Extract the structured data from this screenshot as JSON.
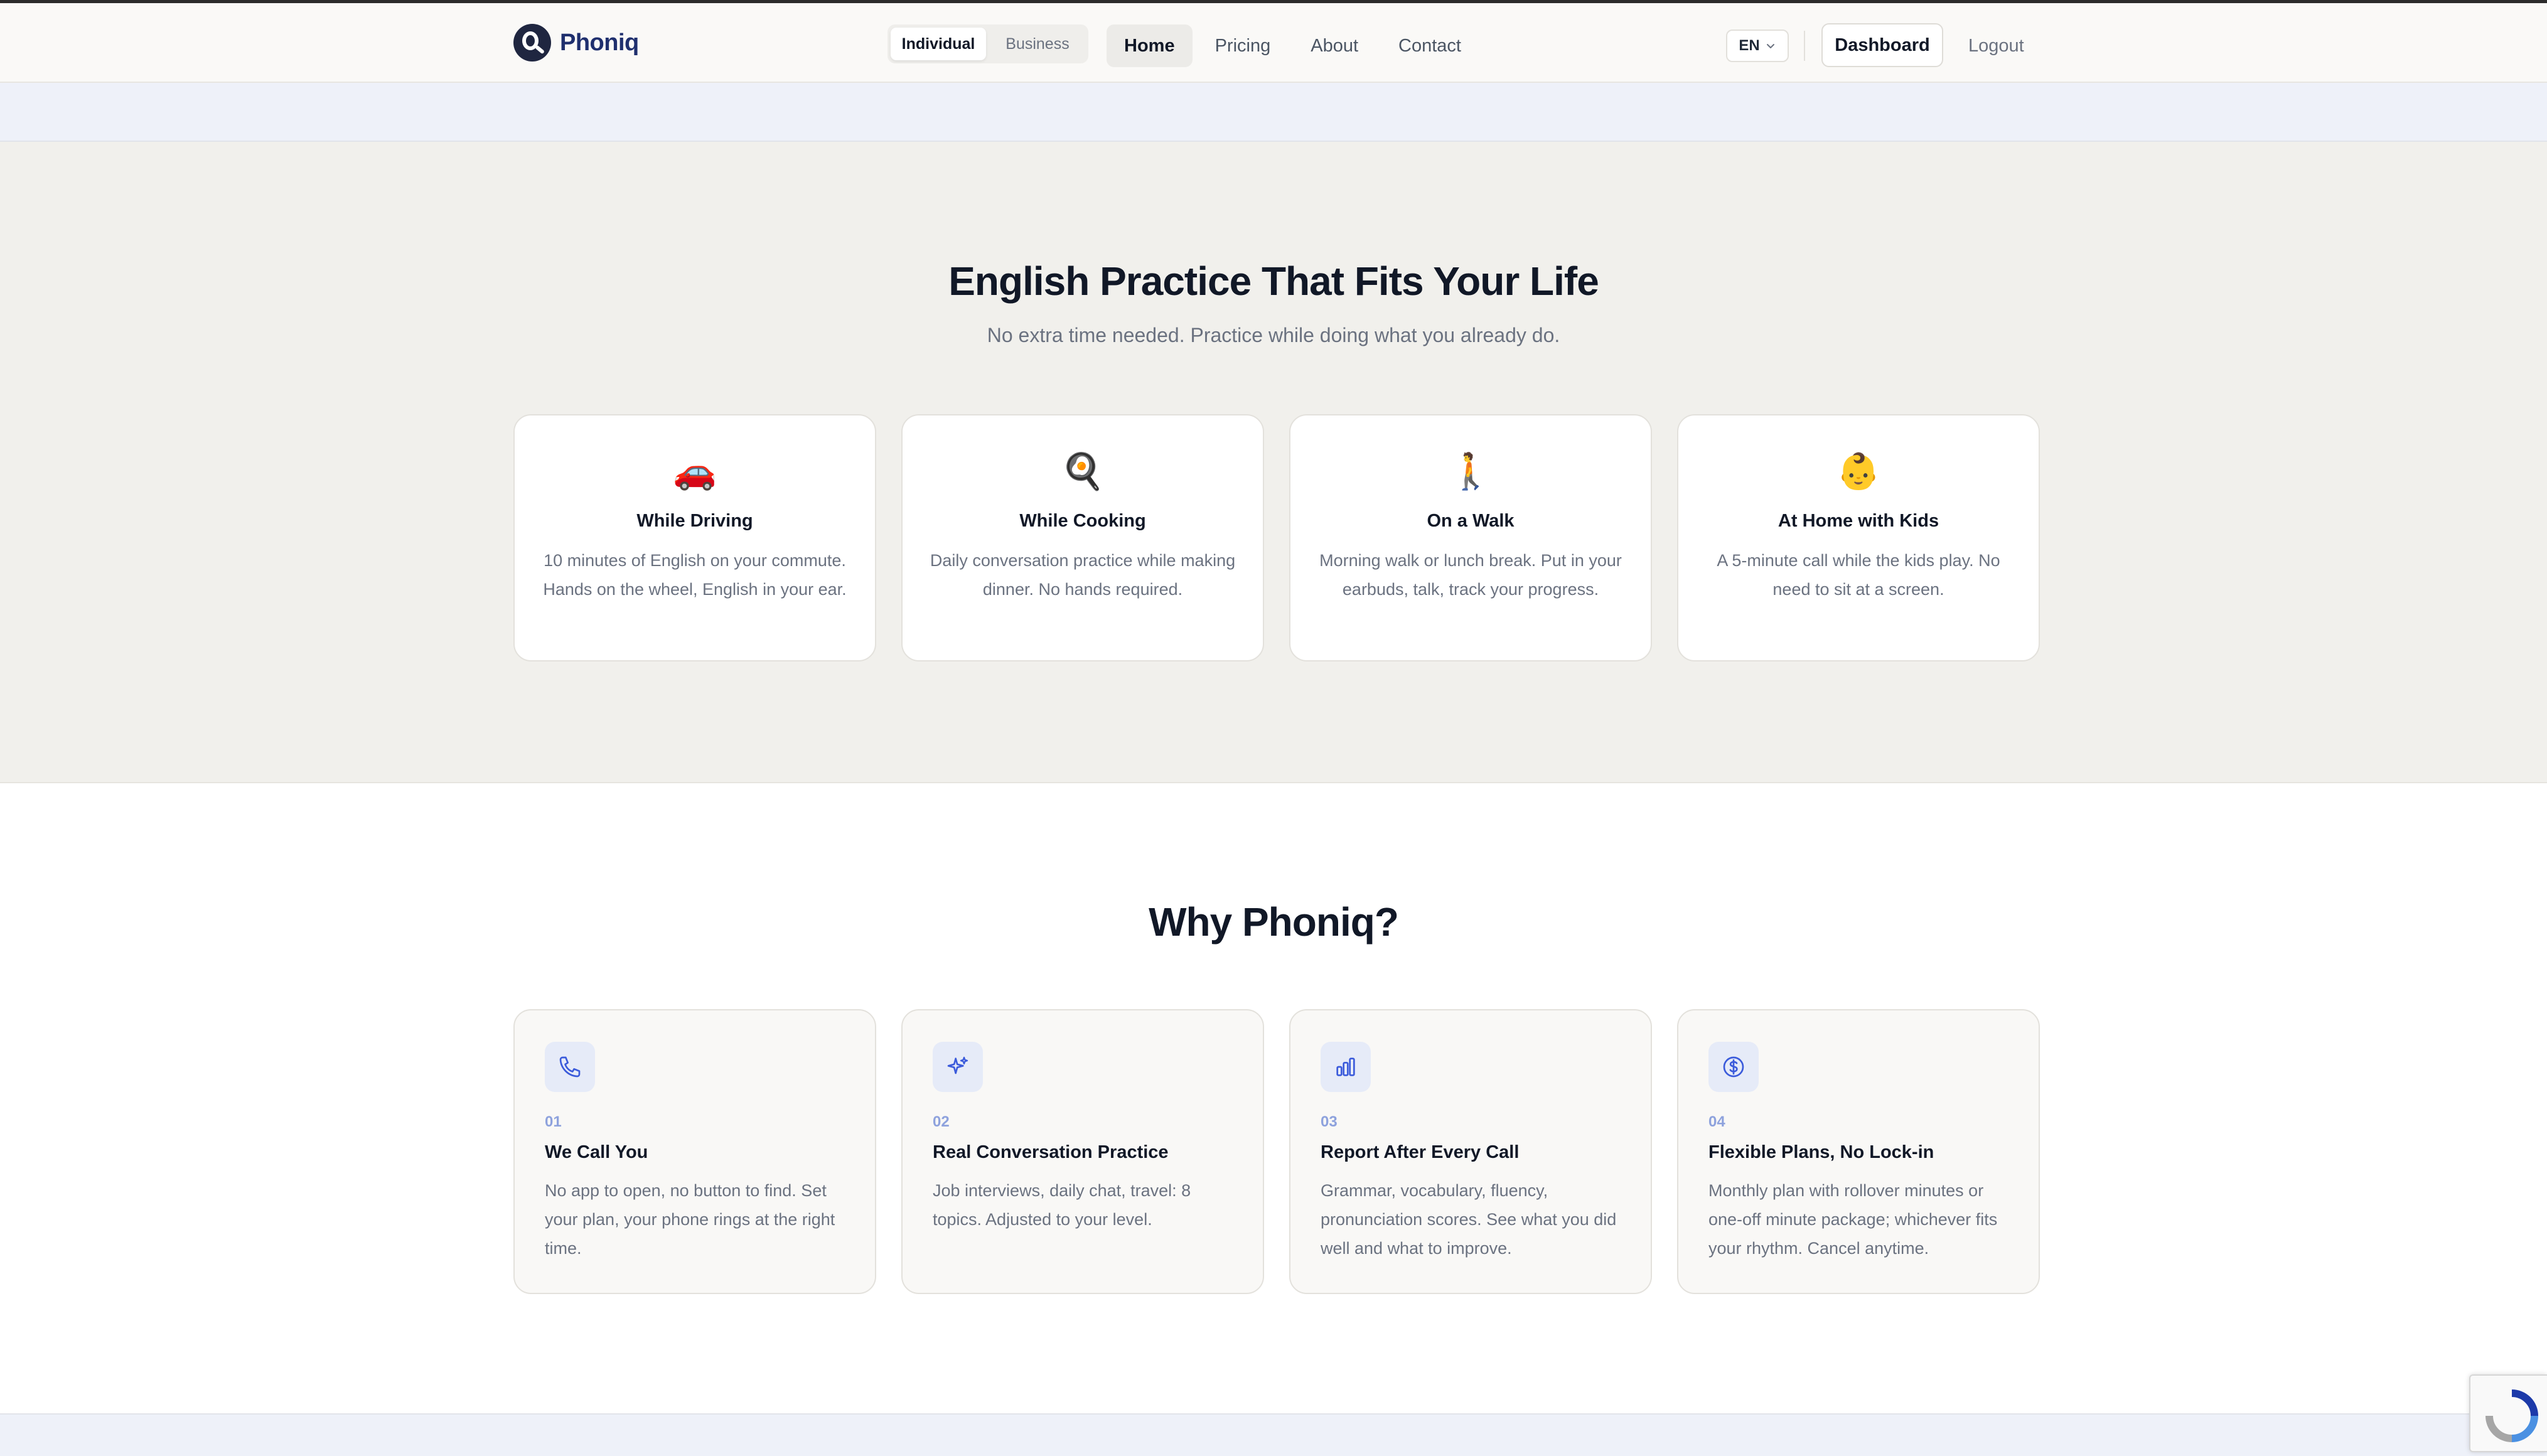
{
  "header": {
    "logo_text": "Phoniq",
    "segment": [
      "Individual",
      "Business"
    ],
    "nav": [
      "Home",
      "Pricing",
      "About",
      "Contact"
    ],
    "lang": "EN",
    "dashboard": "Dashboard",
    "logout": "Logout"
  },
  "life": {
    "title": "English Practice That Fits Your Life",
    "subtitle": "No extra time needed. Practice while doing what you already do.",
    "cards": [
      {
        "emoji": "🚗",
        "title": "While Driving",
        "desc": "10 minutes of English on your commute. Hands on the wheel, English in your ear."
      },
      {
        "emoji": "🍳",
        "title": "While Cooking",
        "desc": "Daily conversation practice while making dinner. No hands required."
      },
      {
        "emoji": "🚶",
        "title": "On a Walk",
        "desc": "Morning walk or lunch break. Put in your earbuds, talk, track your progress."
      },
      {
        "emoji": "👶",
        "title": "At Home with Kids",
        "desc": "A 5-minute call while the kids play. No need to sit at a screen."
      }
    ]
  },
  "why": {
    "title": "Why Phoniq?",
    "cards": [
      {
        "num": "01",
        "icon": "phone-icon",
        "title": "We Call You",
        "desc": "No app to open, no button to find. Set your plan, your phone rings at the right time."
      },
      {
        "num": "02",
        "icon": "sparkles-icon",
        "title": "Real Conversation Practice",
        "desc": "Job interviews, daily chat, travel: 8 topics. Adjusted to your level."
      },
      {
        "num": "03",
        "icon": "bar-chart-icon",
        "title": "Report After Every Call",
        "desc": "Grammar, vocabulary, fluency, pronunciation scores. See what you did well and what to improve."
      },
      {
        "num": "04",
        "icon": "dollar-circle-icon",
        "title": "Flexible Plans, No Lock-in",
        "desc": "Monthly plan with rollover minutes or one-off minute package; whichever fits your rhythm. Cancel anytime."
      }
    ]
  },
  "colors": {
    "accent": "#1f2f6e",
    "icon_blue": "#3b5bdb",
    "section_bg": "#f1f0ec",
    "band_bg": "#eef1f9"
  }
}
